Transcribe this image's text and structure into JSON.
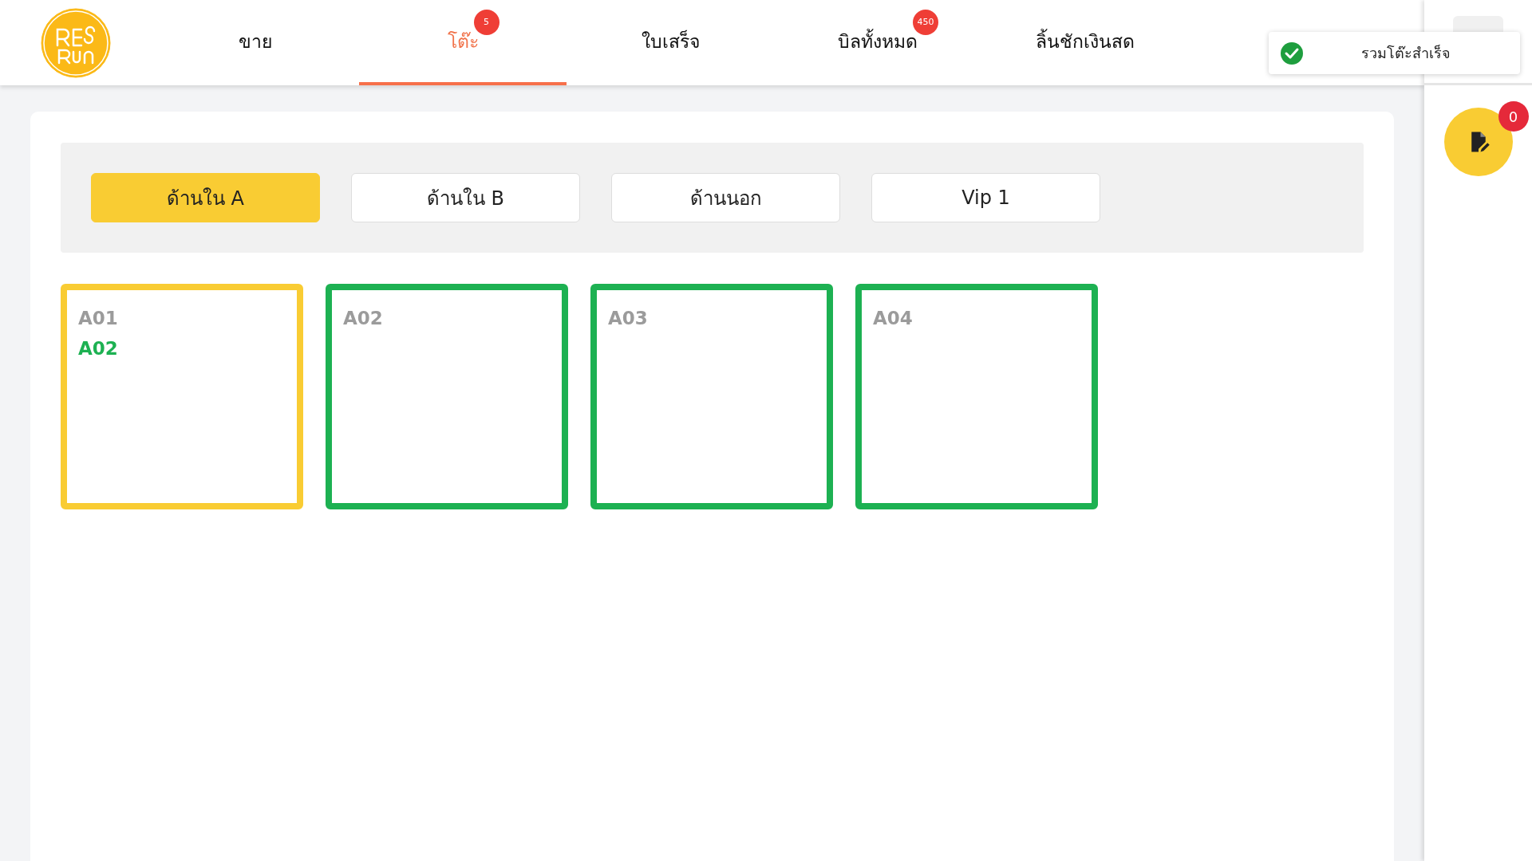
{
  "nav": [
    {
      "label": "ขาย",
      "selected": false
    },
    {
      "label": "โต๊ะ",
      "selected": true,
      "badge": "5"
    },
    {
      "label": "ใบเสร็จ",
      "selected": false
    },
    {
      "label": "บิลทั้งหมด",
      "selected": false,
      "badge": "450"
    },
    {
      "label": "ลิ้นชักเงินสด",
      "selected": false
    }
  ],
  "toast": {
    "message": "รวมโต๊ะสำเร็จ"
  },
  "fab": {
    "badge": "0"
  },
  "zones": [
    {
      "label": "ด้านใน A",
      "selected": true
    },
    {
      "label": "ด้านใน B",
      "selected": false
    },
    {
      "label": "ด้านนอก",
      "selected": false
    },
    {
      "label": "Vip 1",
      "selected": false
    }
  ],
  "tables": [
    {
      "name": "A01",
      "color": "#f9cc33",
      "merged": [
        "A02"
      ]
    },
    {
      "name": "A02",
      "color": "#1db152"
    },
    {
      "name": "A03",
      "color": "#1db152"
    },
    {
      "name": "A04",
      "color": "#1db152"
    }
  ]
}
